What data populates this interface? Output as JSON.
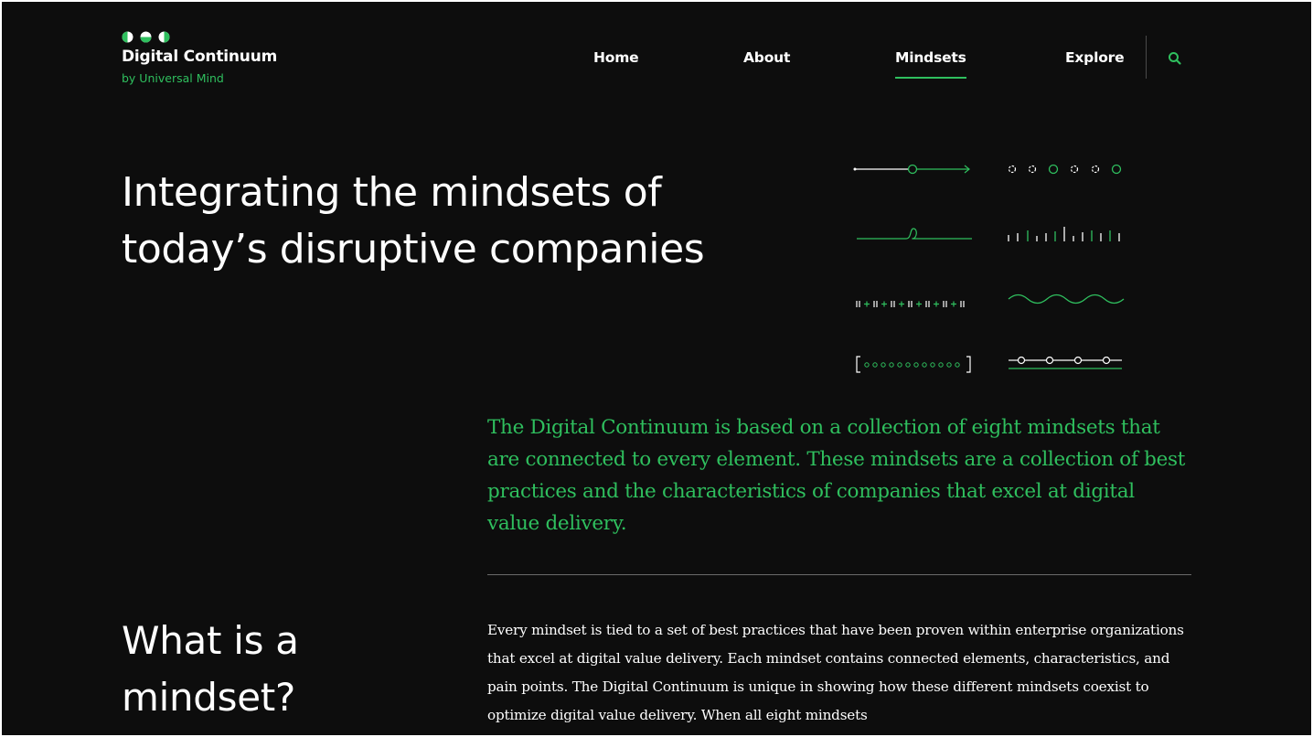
{
  "brand": {
    "name": "Digital Continuum",
    "subtitle": "by Universal Mind",
    "accent_color": "#2fbf5e",
    "background_color": "#0d0d0d"
  },
  "nav": {
    "items": [
      {
        "label": "Home",
        "active": false
      },
      {
        "label": "About",
        "active": false
      },
      {
        "label": "Mindsets",
        "active": true
      },
      {
        "label": "Explore",
        "active": false
      }
    ],
    "search_icon": "search-icon"
  },
  "hero": {
    "title_line1": "Integrating the mindsets of",
    "title_line2": "today’s disruptive companies"
  },
  "mindset_glyphs": {
    "icons": [
      "line-circle-arrow-glyph",
      "dotted-circles-glyph",
      "line-loop-glyph",
      "tick-marks-glyph",
      "plus-separator-glyph",
      "wave-glyph",
      "bracketed-dots-glyph",
      "linked-circles-glyph"
    ]
  },
  "intro": {
    "text": "The Digital Continuum is based on a collection of eight mindsets that are connected to every element. These mindsets are a collection of best practices and the characteristics of companies that excel at digital value delivery."
  },
  "what_is": {
    "heading_line1": "What is a",
    "heading_line2": "mindset?",
    "body": "Every mindset is tied to a set of best practices that have been proven within enterprise organizations that excel at digital value delivery. Each mindset contains connected elements, characteristics, and pain points. The Digital Continuum is unique in showing how these different mindsets coexist to optimize digital value delivery. When all eight mindsets"
  }
}
